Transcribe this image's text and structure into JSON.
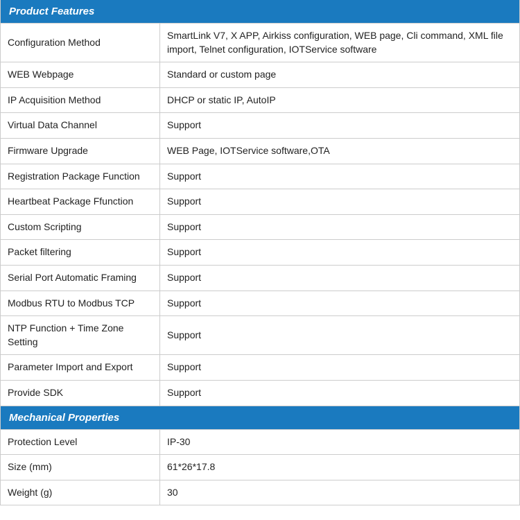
{
  "sections": [
    {
      "type": "header",
      "label": "Product Features"
    },
    {
      "type": "row",
      "label": "Configuration Method",
      "value": "SmartLink V7, X APP, Airkiss configuration, WEB page, Cli command, XML file import, Telnet configuration, IOTService software"
    },
    {
      "type": "row",
      "label": "WEB Webpage",
      "value": "Standard or custom page"
    },
    {
      "type": "row",
      "label": "IP Acquisition Method",
      "value": "DHCP or static IP, AutoIP"
    },
    {
      "type": "row",
      "label": "Virtual Data Channel",
      "value": "Support"
    },
    {
      "type": "row",
      "label": "Firmware Upgrade",
      "value": "WEB Page, IOTService software,OTA"
    },
    {
      "type": "row",
      "label": "Registration Package Function",
      "value": "Support"
    },
    {
      "type": "row",
      "label": "Heartbeat Package Ffunction",
      "value": "Support"
    },
    {
      "type": "row",
      "label": "Custom Scripting",
      "value": "Support"
    },
    {
      "type": "row",
      "label": "Packet filtering",
      "value": "Support"
    },
    {
      "type": "row",
      "label": "Serial Port Automatic Framing",
      "value": "Support"
    },
    {
      "type": "row",
      "label": "Modbus RTU to Modbus TCP",
      "value": "Support"
    },
    {
      "type": "row",
      "label": "NTP Function + Time Zone Setting",
      "value": "Support"
    },
    {
      "type": "row",
      "label": "Parameter Import and Export",
      "value": "Support"
    },
    {
      "type": "row",
      "label": "Provide SDK",
      "value": "Support"
    },
    {
      "type": "header",
      "label": "Mechanical Properties"
    },
    {
      "type": "row",
      "label": "Protection Level",
      "value": "IP-30"
    },
    {
      "type": "row",
      "label": "Size (mm)",
      "value": "61*26*17.8"
    },
    {
      "type": "row",
      "label": "Weight (g)",
      "value": "30"
    }
  ]
}
